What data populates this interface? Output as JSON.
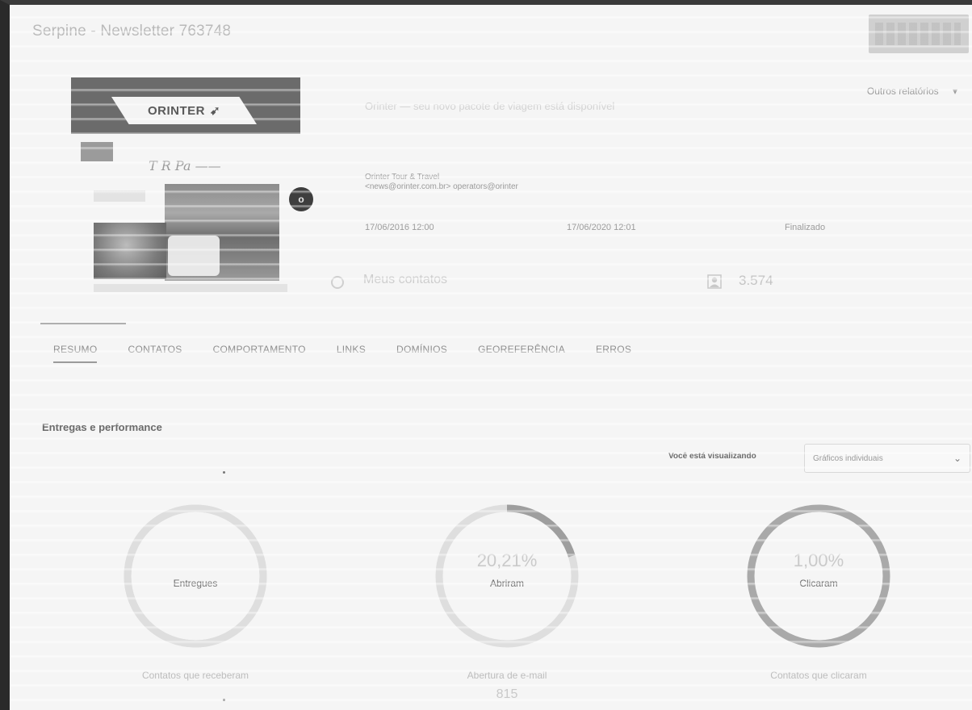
{
  "window": {
    "title": "Serpine - Newsletter 763748"
  },
  "header": {
    "tools_label": "Outros relatórios",
    "tools_chevron": "›"
  },
  "preview": {
    "brand": "ORINTER",
    "handwriting": "T R Pa ——",
    "badge": "o"
  },
  "email_info": {
    "subject": "Orinter — seu novo pacote de viagem está disponível",
    "sender_name": "Orinter Tour & Travel",
    "sender_email": "<news@orinter.com.br> operators@orinter",
    "start_date": "17/06/2016 12:00",
    "end_date": "17/06/2020 12:01",
    "status": "Finalizado",
    "list_name": "Meus contatos",
    "contacts_count": "3.574"
  },
  "tabs": [
    {
      "label": "RESUMO",
      "active": true
    },
    {
      "label": "CONTATOS",
      "active": false
    },
    {
      "label": "COMPORTAMENTO",
      "active": false
    },
    {
      "label": "LINKS",
      "active": false
    },
    {
      "label": "DOMÍNIOS",
      "active": false
    },
    {
      "label": "GEOREFERÊNCIA",
      "active": false
    },
    {
      "label": "ERROS",
      "active": false
    }
  ],
  "section": {
    "title": "Entregas e performance",
    "viewing_label": "Você está visualizando",
    "view_select": "Gráficos individuais"
  },
  "metrics": [
    {
      "percent": "",
      "label": "Entregues",
      "caption": "Contatos que receberam",
      "value": "",
      "fraction": 1.0
    },
    {
      "percent": "20,21%",
      "label": "Abriram",
      "caption": "Abertura de e-mail",
      "value": "815",
      "fraction": 0.2021
    },
    {
      "percent": "1,00%",
      "label": "Clicaram",
      "caption": "Contatos que clicaram",
      "value": "",
      "fraction": 1.0
    }
  ],
  "colors": {
    "ring_track": "#dedede",
    "ring_fill": "#9e9e9e",
    "ring_full_gray": "#a9a9a9"
  }
}
